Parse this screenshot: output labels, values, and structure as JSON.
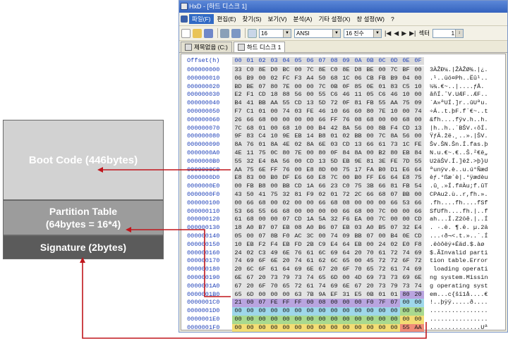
{
  "diagram": {
    "boot_code": "Boot Code (446bytes)",
    "partition_line1": "Partition Table",
    "partition_line2": "(64bytes = 16*4)",
    "signature": "Signature (2bytes)"
  },
  "window": {
    "title": "HxD - [하드 디스크 1]",
    "menu": [
      "파일(F)",
      "편집(E)",
      "찾기(S)",
      "보기(V)",
      "분석(A)",
      "기타 설정(X)",
      "창 설정(W)",
      "?"
    ],
    "toolbar": {
      "bytes_per_row": "16",
      "charset": "ANSI",
      "base": "16 진수",
      "sector_label": "섹터",
      "sector_value": "1"
    },
    "tabs": [
      "제목없음 (C:)",
      "하드 디스크 1"
    ]
  },
  "hex": {
    "offset_label": "Offset(h)",
    "columns": [
      "00",
      "01",
      "02",
      "03",
      "04",
      "05",
      "06",
      "07",
      "08",
      "09",
      "0A",
      "0B",
      "0C",
      "0D",
      "0E",
      "0F"
    ],
    "rows": [
      {
        "off": "000000000",
        "bytes": [
          "33",
          "C0",
          "8E",
          "D0",
          "BC",
          "00",
          "7C",
          "8E",
          "C0",
          "8E",
          "D8",
          "BE",
          "00",
          "7C",
          "BF",
          "00"
        ],
        "ascii": "3ÀŽÐ¼.|ŽÀŽØ¾.|¿."
      },
      {
        "off": "000000010",
        "bytes": [
          "06",
          "B9",
          "00",
          "02",
          "FC",
          "F3",
          "A4",
          "50",
          "68",
          "1C",
          "06",
          "CB",
          "FB",
          "B9",
          "04",
          "00"
        ],
        "ascii": ".¹..üó¤Ph..Ëû¹.."
      },
      {
        "off": "000000020",
        "bytes": [
          "BD",
          "BE",
          "07",
          "80",
          "7E",
          "00",
          "00",
          "7C",
          "0B",
          "0F",
          "85",
          "0E",
          "01",
          "83",
          "C5",
          "10"
        ],
        "ascii": "½¾.€~..|....ƒÅ."
      },
      {
        "off": "000000030",
        "bytes": [
          "E2",
          "F1",
          "CD",
          "18",
          "88",
          "56",
          "00",
          "55",
          "C6",
          "46",
          "11",
          "05",
          "C6",
          "46",
          "10",
          "00"
        ],
        "ascii": "âñÍ.ˆV.UÆF..ÆF.."
      },
      {
        "off": "000000040",
        "bytes": [
          "B4",
          "41",
          "BB",
          "AA",
          "55",
          "CD",
          "13",
          "5D",
          "72",
          "0F",
          "81",
          "FB",
          "55",
          "AA",
          "75",
          "09"
        ],
        "ascii": "´A»ªUÍ.]r..ûUªu."
      },
      {
        "off": "000000050",
        "bytes": [
          "F7",
          "C1",
          "01",
          "00",
          "74",
          "03",
          "FE",
          "46",
          "10",
          "66",
          "60",
          "80",
          "7E",
          "10",
          "00",
          "74"
        ],
        "ascii": "÷Á..t.þF.f`€~..t"
      },
      {
        "off": "000000060",
        "bytes": [
          "26",
          "66",
          "68",
          "00",
          "00",
          "00",
          "00",
          "66",
          "FF",
          "76",
          "08",
          "68",
          "00",
          "00",
          "68",
          "00"
        ],
        "ascii": "&fh....fÿv.h..h."
      },
      {
        "off": "000000070",
        "bytes": [
          "7C",
          "68",
          "01",
          "00",
          "68",
          "10",
          "00",
          "B4",
          "42",
          "8A",
          "56",
          "00",
          "8B",
          "F4",
          "CD",
          "13"
        ],
        "ascii": "|h..h..´BŠV.‹ôÍ."
      },
      {
        "off": "000000080",
        "bytes": [
          "9F",
          "83",
          "C4",
          "10",
          "9E",
          "EB",
          "14",
          "B8",
          "01",
          "02",
          "BB",
          "00",
          "7C",
          "8A",
          "56",
          "00"
        ],
        "ascii": "ŸƒÄ.žë.¸..».|ŠV."
      },
      {
        "off": "000000090",
        "bytes": [
          "8A",
          "76",
          "01",
          "8A",
          "4E",
          "02",
          "8A",
          "6E",
          "03",
          "CD",
          "13",
          "66",
          "61",
          "73",
          "1C",
          "FE"
        ],
        "ascii": "Šv.ŠN.Šn.Í.fas.þ"
      },
      {
        "off": "0000000A0",
        "bytes": [
          "4E",
          "11",
          "75",
          "0C",
          "80",
          "7E",
          "00",
          "80",
          "0F",
          "84",
          "8A",
          "00",
          "B2",
          "80",
          "EB",
          "84"
        ],
        "ascii": "N.u.€~.€..Š.²€ë„"
      },
      {
        "off": "0000000B0",
        "bytes": [
          "55",
          "32",
          "E4",
          "8A",
          "56",
          "00",
          "CD",
          "13",
          "5D",
          "EB",
          "9E",
          "81",
          "3E",
          "FE",
          "7D",
          "55"
        ],
        "ascii": "U2äŠV.Í.]ëž.>þ}U"
      },
      {
        "off": "0000000C0",
        "bytes": [
          "AA",
          "75",
          "6E",
          "FF",
          "76",
          "00",
          "E8",
          "8D",
          "00",
          "75",
          "17",
          "FA",
          "B0",
          "D1",
          "E6",
          "64"
        ],
        "ascii": "ªunÿv.è..u.ú°Ñæd"
      },
      {
        "off": "0000000D0",
        "bytes": [
          "E8",
          "83",
          "00",
          "B0",
          "DF",
          "E6",
          "60",
          "E8",
          "7C",
          "00",
          "B0",
          "FF",
          "E6",
          "64",
          "E8",
          "75"
        ],
        "ascii": "èƒ.°ßæ`è|.°ÿædèu"
      },
      {
        "off": "0000000E0",
        "bytes": [
          "00",
          "FB",
          "B8",
          "00",
          "BB",
          "CD",
          "1A",
          "66",
          "23",
          "C0",
          "75",
          "3B",
          "66",
          "81",
          "FB",
          "54"
        ],
        "ascii": ".û¸.»Í.f#Àu;f.ûT"
      },
      {
        "off": "0000000F0",
        "bytes": [
          "43",
          "50",
          "41",
          "75",
          "32",
          "81",
          "F9",
          "02",
          "01",
          "72",
          "2C",
          "66",
          "68",
          "07",
          "BB",
          "00"
        ],
        "ascii": "CPAu2.ù..r,fh.»."
      },
      {
        "off": "000000100",
        "bytes": [
          "00",
          "66",
          "68",
          "00",
          "02",
          "00",
          "00",
          "66",
          "68",
          "08",
          "00",
          "00",
          "00",
          "66",
          "53",
          "66"
        ],
        "ascii": ".fh....fh....fSf"
      },
      {
        "off": "000000110",
        "bytes": [
          "53",
          "66",
          "55",
          "66",
          "68",
          "00",
          "00",
          "00",
          "00",
          "66",
          "68",
          "00",
          "7C",
          "00",
          "00",
          "66"
        ],
        "ascii": "SfUfh....fh.|..f"
      },
      {
        "off": "000000120",
        "bytes": [
          "61",
          "68",
          "00",
          "00",
          "07",
          "CD",
          "1A",
          "5A",
          "32",
          "F6",
          "EA",
          "00",
          "7C",
          "00",
          "00",
          "CD"
        ],
        "ascii": "ah...Í.Z2öê.|..Í"
      },
      {
        "off": "000000130",
        "bytes": [
          "18",
          "A0",
          "B7",
          "07",
          "EB",
          "08",
          "A0",
          "B6",
          "07",
          "EB",
          "03",
          "A0",
          "B5",
          "07",
          "32",
          "E4"
        ],
        "ascii": ". ·.ë. ¶.ë. µ.2ä"
      },
      {
        "off": "000000140",
        "bytes": [
          "05",
          "00",
          "07",
          "8B",
          "F0",
          "AC",
          "3C",
          "00",
          "74",
          "09",
          "BB",
          "07",
          "00",
          "B4",
          "0E",
          "CD"
        ],
        "ascii": "...‹ð¬<.t.»..´.Í"
      },
      {
        "off": "000000150",
        "bytes": [
          "10",
          "EB",
          "F2",
          "F4",
          "EB",
          "FD",
          "2B",
          "C9",
          "E4",
          "64",
          "EB",
          "00",
          "24",
          "02",
          "E0",
          "F8"
        ],
        "ascii": ".ëòôëý+Éäd.$.àø"
      },
      {
        "off": "000000160",
        "bytes": [
          "24",
          "02",
          "C3",
          "49",
          "6E",
          "76",
          "61",
          "6C",
          "69",
          "64",
          "20",
          "70",
          "61",
          "72",
          "74",
          "69"
        ],
        "ascii": "$.ÃInvalid parti"
      },
      {
        "off": "000000170",
        "bytes": [
          "74",
          "69",
          "6F",
          "6E",
          "20",
          "74",
          "61",
          "62",
          "6C",
          "65",
          "00",
          "45",
          "72",
          "72",
          "6F",
          "72"
        ],
        "ascii": "tion table.Error"
      },
      {
        "off": "000000180",
        "bytes": [
          "20",
          "6C",
          "6F",
          "61",
          "64",
          "69",
          "6E",
          "67",
          "20",
          "6F",
          "70",
          "65",
          "72",
          "61",
          "74",
          "69"
        ],
        "ascii": " loading operati"
      },
      {
        "off": "000000190",
        "bytes": [
          "6E",
          "67",
          "20",
          "73",
          "79",
          "73",
          "74",
          "65",
          "6D",
          "00",
          "4D",
          "69",
          "73",
          "73",
          "69",
          "6E"
        ],
        "ascii": "ng system.Missin"
      },
      {
        "off": "0000001A0",
        "bytes": [
          "67",
          "20",
          "6F",
          "70",
          "65",
          "72",
          "61",
          "74",
          "69",
          "6E",
          "67",
          "20",
          "73",
          "79",
          "73",
          "74"
        ],
        "ascii": "g operating syst"
      },
      {
        "off": "0000001B0",
        "bytes": [
          "65",
          "6D",
          "00",
          "00",
          "00",
          "63",
          "7B",
          "9A",
          "EF",
          "31",
          "E5",
          "0B",
          "01",
          "01",
          "80",
          "20"
        ],
        "ascii": "em...c{šï1å....€ "
      },
      {
        "off": "0000001C0",
        "bytes": [
          "21",
          "00",
          "07",
          "FE",
          "FF",
          "FF",
          "00",
          "08",
          "00",
          "00",
          "00",
          "F0",
          "7F",
          "07",
          "00",
          "00"
        ],
        "ascii": "!..þÿÿ.....ð...."
      },
      {
        "off": "0000001D0",
        "bytes": [
          "00",
          "00",
          "00",
          "00",
          "00",
          "00",
          "00",
          "00",
          "00",
          "00",
          "00",
          "00",
          "00",
          "00",
          "00",
          "00"
        ],
        "ascii": "................"
      },
      {
        "off": "0000001E0",
        "bytes": [
          "00",
          "00",
          "00",
          "00",
          "00",
          "00",
          "00",
          "00",
          "00",
          "00",
          "00",
          "00",
          "00",
          "00",
          "00",
          "00"
        ],
        "ascii": "................"
      },
      {
        "off": "0000001F0",
        "bytes": [
          "00",
          "00",
          "00",
          "00",
          "00",
          "00",
          "00",
          "00",
          "00",
          "00",
          "00",
          "00",
          "00",
          "00",
          "55",
          "AA"
        ],
        "ascii": "..............Uª"
      }
    ]
  },
  "colors": {
    "partition_entry_1": "#b9a4df",
    "partition_entry_2": "#9ed7ea",
    "partition_entry_3": "#a9d98f",
    "partition_entry_4": "#f3dd74",
    "signature": "#f08c78",
    "arrow": "#c0161c"
  }
}
